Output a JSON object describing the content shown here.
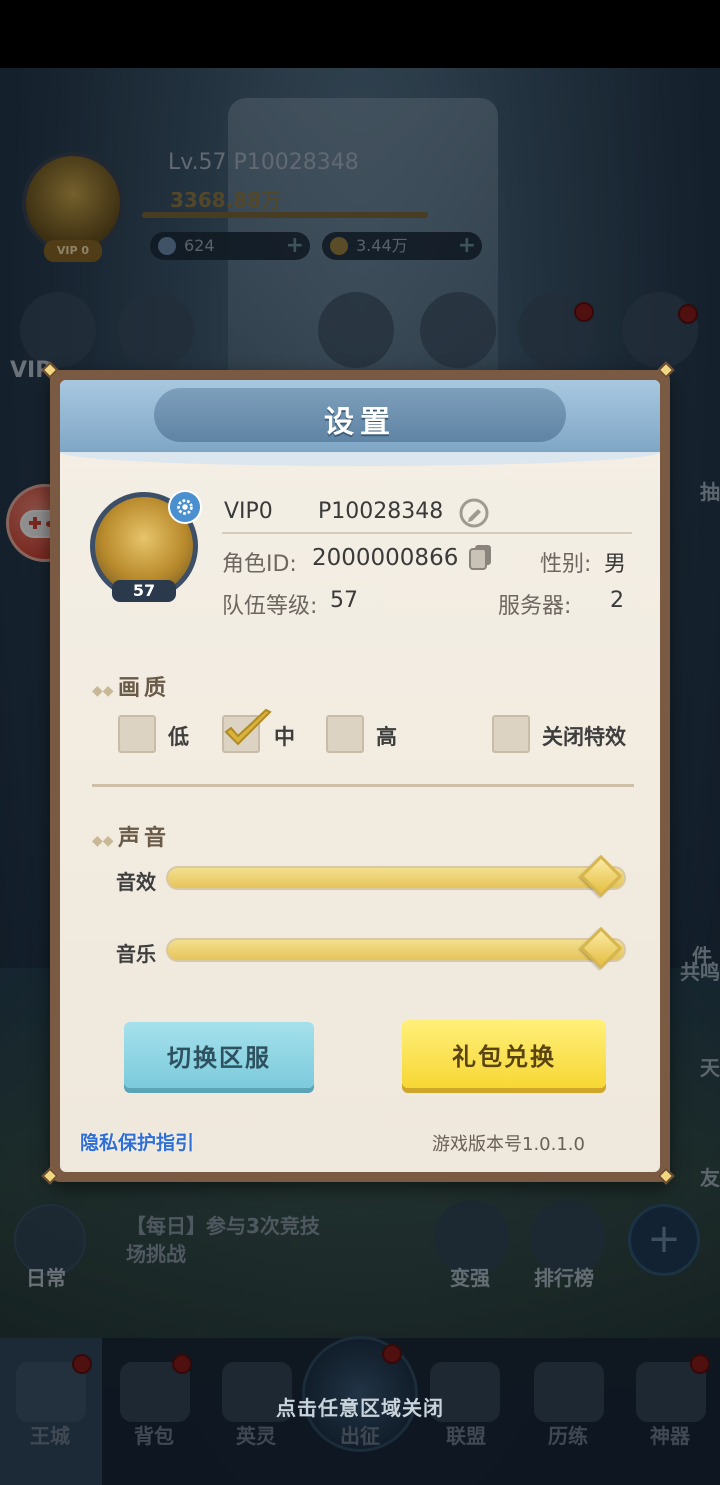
{
  "hud": {
    "level_id": "Lv.57   P10028348",
    "power": "3368.88万",
    "vip_tag": "VIP 0",
    "gems": "624",
    "coins": "3.44万",
    "vip_side": "VIP"
  },
  "right_side": {
    "draw": "抽",
    "mail": "件",
    "shared": "共鸣",
    "chat": "天",
    "friends": "友"
  },
  "dialog": {
    "title": "设置",
    "profile": {
      "vip": "VIP0",
      "player_id": "P10028348",
      "role_id_label": "角色ID:",
      "role_id": "2000000866",
      "gender_label": "性别:",
      "gender": "男",
      "team_level_label": "队伍等级:",
      "team_level": "57",
      "server_label": "服务器:",
      "server": "2",
      "avatar_level": "57"
    },
    "quality": {
      "heading": "画质",
      "options": [
        {
          "label": "低",
          "checked": false
        },
        {
          "label": "中",
          "checked": true
        },
        {
          "label": "高",
          "checked": false
        },
        {
          "label": "关闭特效",
          "checked": false
        }
      ]
    },
    "sound": {
      "heading": "声音",
      "sfx_label": "音效",
      "sfx_level": 1.0,
      "music_label": "音乐",
      "music_level": 1.0
    },
    "buttons": {
      "switch_server": "切换区服",
      "gift_redeem": "礼包兑换"
    },
    "privacy_link": "隐私保护指引",
    "version": "游戏版本号1.0.1.0"
  },
  "bottom": {
    "daily_label": "日常",
    "daily_task_line1": "【每日】参与3次竞技",
    "daily_task_line2": "场挑战",
    "strengthen": "变强",
    "ranking": "排行榜",
    "tap_to_close": "点击任意区域关闭",
    "nav": [
      "王城",
      "背包",
      "英灵",
      "出征",
      "联盟",
      "历练",
      "神器"
    ]
  },
  "colors": {
    "accent_blue": "#7fa6c6",
    "gift_yellow": "#f7d735",
    "switch_cyan": "#7ccadc",
    "link_blue": "#2f6fd6"
  }
}
